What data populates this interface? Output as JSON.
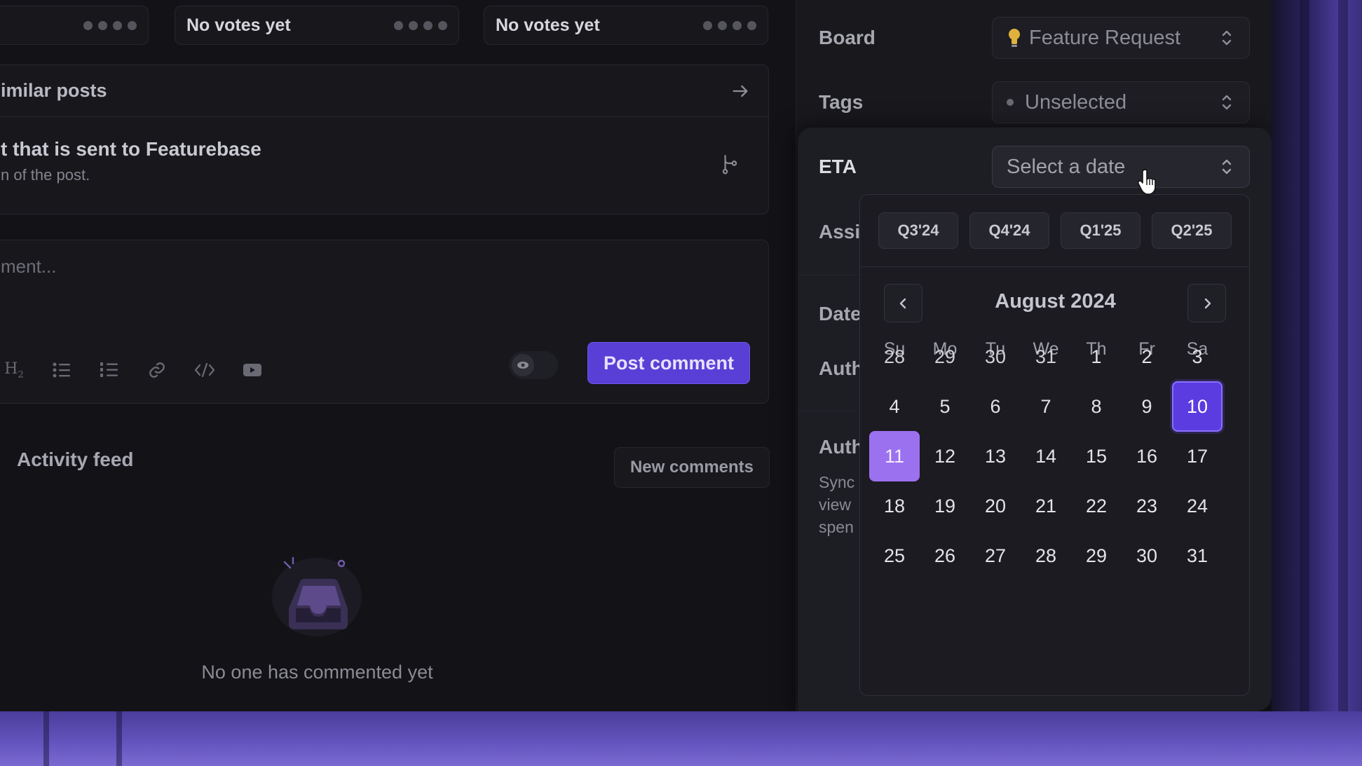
{
  "votes": [
    {
      "label": ""
    },
    {
      "label": "No votes yet"
    },
    {
      "label": "No votes yet"
    }
  ],
  "similar": {
    "title": "imilar posts",
    "line1": "t that is sent to Featurebase",
    "line2": "n of the post."
  },
  "editor": {
    "placeholder": "ment...",
    "post_label": "Post comment",
    "tools": [
      "heading-2-icon",
      "bullet-list-icon",
      "numbered-list-icon",
      "link-icon",
      "code-icon",
      "video-icon"
    ]
  },
  "activity": {
    "title": "Activity feed",
    "new_comments_label": "New comments",
    "empty_text": "No one has commented yet"
  },
  "sidebar": {
    "board_label": "Board",
    "board_value": "Feature Request",
    "tags_label": "Tags",
    "tags_value": "Unselected",
    "eta_label": "ETA",
    "eta_value": "Select a date",
    "frag_assignee": "Assi",
    "frag_date": "Date",
    "frag_author1": "Auth",
    "frag_author2": "Auth",
    "frag_sync1": "Sync",
    "frag_sync2": "view",
    "frag_sync3": "spen"
  },
  "calendar": {
    "quarters": [
      "Q3'24",
      "Q4'24",
      "Q1'25",
      "Q2'25"
    ],
    "month": "August 2024",
    "weekdays": [
      "Su",
      "Mo",
      "Tu",
      "We",
      "Th",
      "Fr",
      "Sa"
    ],
    "weeks": [
      [
        "28",
        "29",
        "30",
        "31",
        "1",
        "2",
        "3"
      ],
      [
        "4",
        "5",
        "6",
        "7",
        "8",
        "9",
        "10"
      ],
      [
        "11",
        "12",
        "13",
        "14",
        "15",
        "16",
        "17"
      ],
      [
        "18",
        "19",
        "20",
        "21",
        "22",
        "23",
        "24"
      ],
      [
        "25",
        "26",
        "27",
        "28",
        "29",
        "30",
        "31"
      ]
    ],
    "selected": "10",
    "today": "11"
  },
  "colors": {
    "accent": "#5b3ce0",
    "today": "#9c71f0",
    "background": "#131317"
  }
}
